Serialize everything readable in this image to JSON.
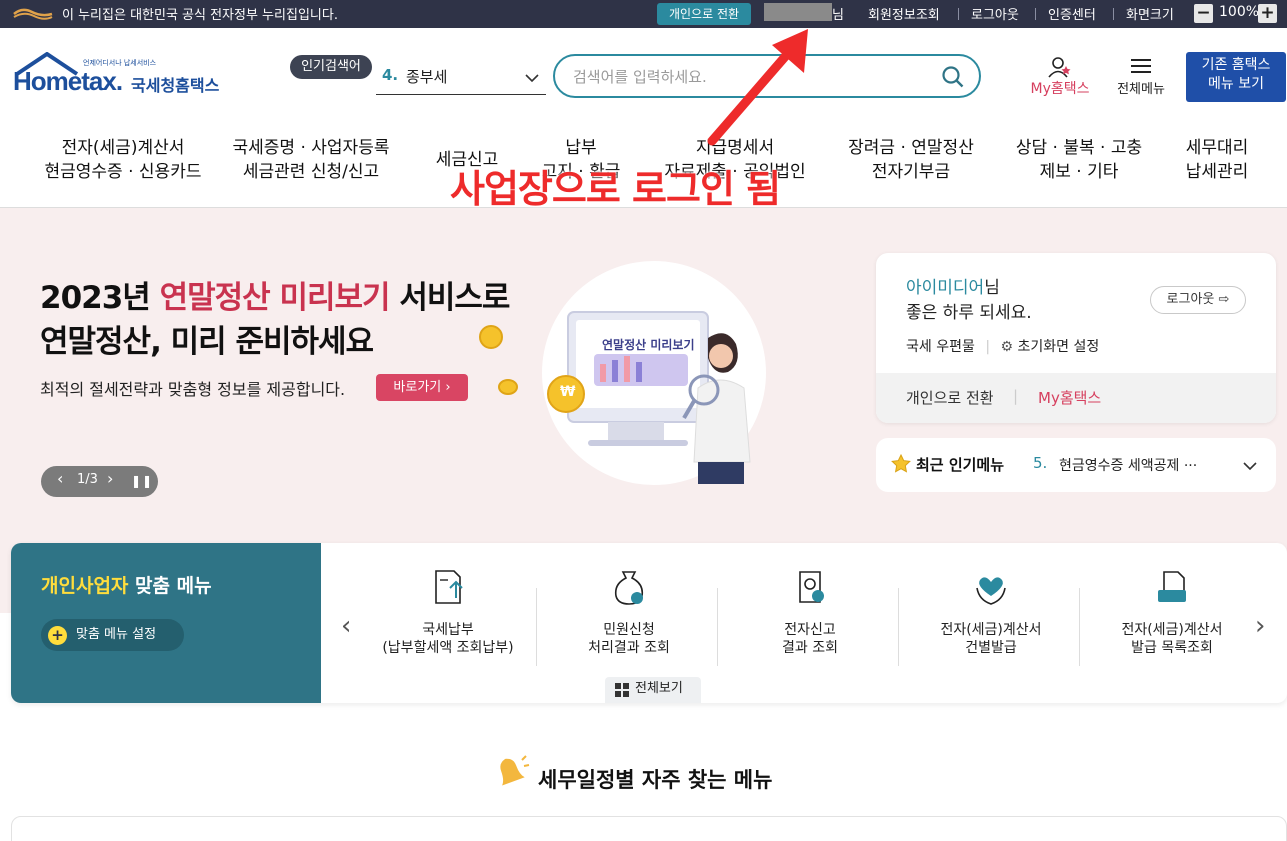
{
  "gov_bar": {
    "notice": "이 누리집은 대한민국 공식 전자정부 누리집입니다.",
    "switch_label": "개인으로 전환",
    "user_suffix": "님",
    "links": [
      "회원정보조회",
      "로그아웃",
      "인증센터",
      "화면크기"
    ],
    "zoom_minus": "−",
    "zoom_value": "100%",
    "zoom_plus": "+"
  },
  "header": {
    "logo_tagline": "언제어디서나 납세서비스",
    "logo_name": "Hometax.",
    "logo_kr": "국세청홈택스",
    "popular_tag": "인기검색어",
    "popular_num": "4.",
    "popular_term": "종부세",
    "search_placeholder": "검색어를 입력하세요.",
    "my_hometax": "My홈택스",
    "all_menu": "전체메뉴",
    "old_home_line1": "기존 홈택스",
    "old_home_line2": "메뉴 보기"
  },
  "nav": [
    {
      "l1": "전자(세금)계산서",
      "l2": "현금영수증 · 신용카드"
    },
    {
      "l1": "국세증명 · 사업자등록",
      "l2": "세금관련 신청/신고"
    },
    {
      "l1": "세금신고",
      "l2": ""
    },
    {
      "l1": "납부",
      "l2": "고지 · 환급"
    },
    {
      "l1": "지급명세서",
      "l2": "자료제출 · 공익법인"
    },
    {
      "l1": "장려금 · 연말정산",
      "l2": "전자기부금"
    },
    {
      "l1": "상담 · 불복 · 고충",
      "l2": "제보 · 기타"
    },
    {
      "l1": "세무대리",
      "l2": "납세관리"
    }
  ],
  "hero": {
    "title_pre": "2023년 ",
    "title_hl": "연말정산 미리보기",
    "title_post": " 서비스로",
    "title2": "연말정산, 미리 준비하세요",
    "desc": "최적의 절세전략과 맞춤형 정보를 제공합니다.",
    "go_label": "바로가기",
    "pager": "1/3",
    "art_label": "연말정산 미리보기",
    "coin_symbol": "₩"
  },
  "login_card": {
    "name": "아이미디어",
    "name_suffix": "님",
    "greet": "좋은 하루 되세요.",
    "logout": "로그아웃",
    "mail": "국세 우편물",
    "init_setting": "초기화면 설정",
    "switch_personal": "개인으로 전환",
    "my_hometax": "My홈택스"
  },
  "recent": {
    "label": "최근 인기메뉴",
    "num": "5.",
    "item": "현금영수증 세액공제 ···"
  },
  "custom_menu": {
    "title_hl": "개인사업자",
    "title_rest": " 맞춤 메뉴",
    "setting": "맞춤 메뉴 설정",
    "items": [
      {
        "l1": "국세납부",
        "l2": "(납부할세액 조회납부)"
      },
      {
        "l1": "민원신청",
        "l2": "처리결과 조회"
      },
      {
        "l1": "전자신고",
        "l2": "결과 조회"
      },
      {
        "l1": "전자(세금)계산서",
        "l2": "건별발급"
      },
      {
        "l1": "전자(세금)계산서",
        "l2": "발급 목록조회"
      }
    ],
    "all_view": "전체보기"
  },
  "schedule": {
    "title": "세무일정별 자주 찾는 메뉴"
  },
  "annotation": {
    "text": "사업장으로 로그인 됨",
    "color": "#ee2b2b"
  },
  "colors": {
    "teal": "#2b8a9f",
    "pink": "#d94563",
    "navy": "#1f4fa8"
  }
}
